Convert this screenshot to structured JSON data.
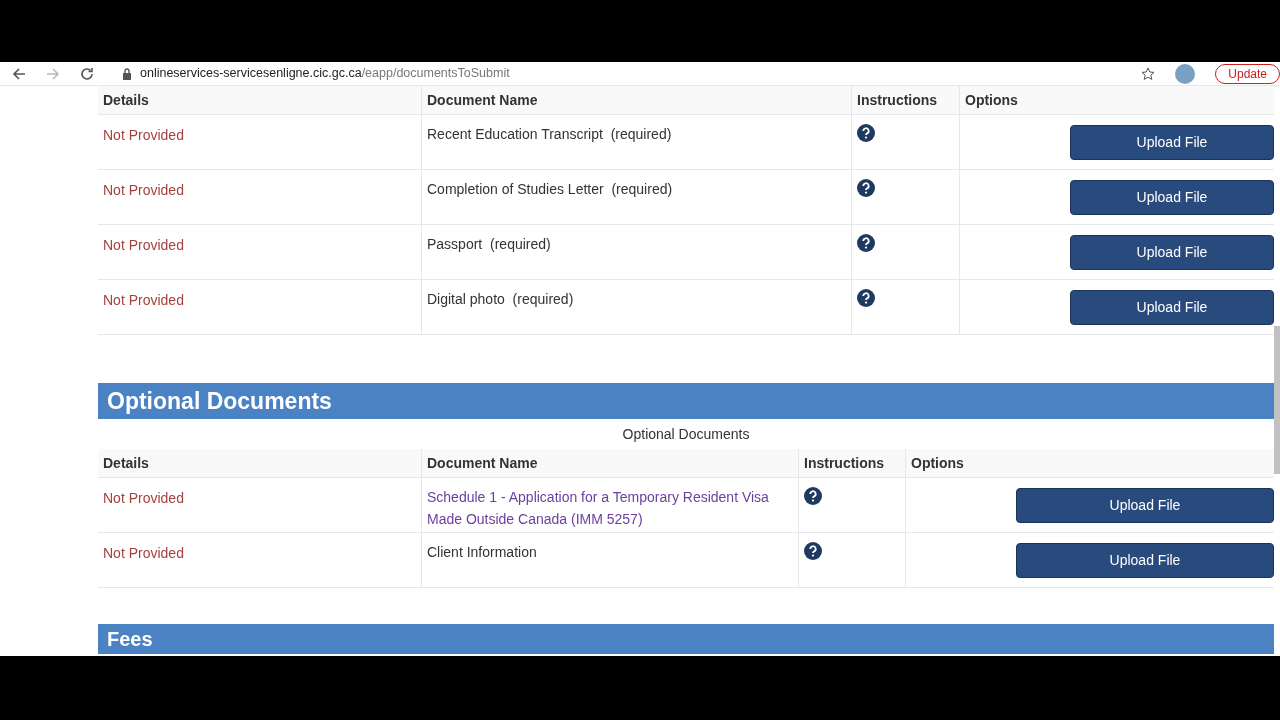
{
  "browser": {
    "url_host": "onlineservices-servicesenligne.cic.gc.ca",
    "url_path": "/eapp/documentsToSubmit",
    "update_button": "Update"
  },
  "required_table": {
    "columns": [
      "Details",
      "Document Name",
      "Instructions",
      "Options"
    ],
    "rows": [
      {
        "details": "Not Provided",
        "document": "Recent Education Transcript  (required)",
        "kind": "text",
        "action": "Upload File"
      },
      {
        "details": "Not Provided",
        "document": "Completion of Studies Letter  (required)",
        "kind": "text",
        "action": "Upload File"
      },
      {
        "details": "Not Provided",
        "document": "Passport  (required)",
        "kind": "text",
        "action": "Upload File"
      },
      {
        "details": "Not Provided",
        "document": "Digital photo  (required)",
        "kind": "text",
        "action": "Upload File"
      }
    ]
  },
  "optional_section": {
    "title": "Optional Documents",
    "caption": "Optional Documents",
    "columns": [
      "Details",
      "Document Name",
      "Instructions",
      "Options"
    ],
    "rows": [
      {
        "details": "Not Provided",
        "document": "Schedule 1 - Application for a Temporary Resident Visa Made Outside Canada (IMM 5257)",
        "kind": "link",
        "action": "Upload File"
      },
      {
        "details": "Not Provided",
        "document": "Client Information",
        "kind": "text",
        "action": "Upload File"
      }
    ]
  },
  "fees_section": {
    "title": "Fees"
  }
}
